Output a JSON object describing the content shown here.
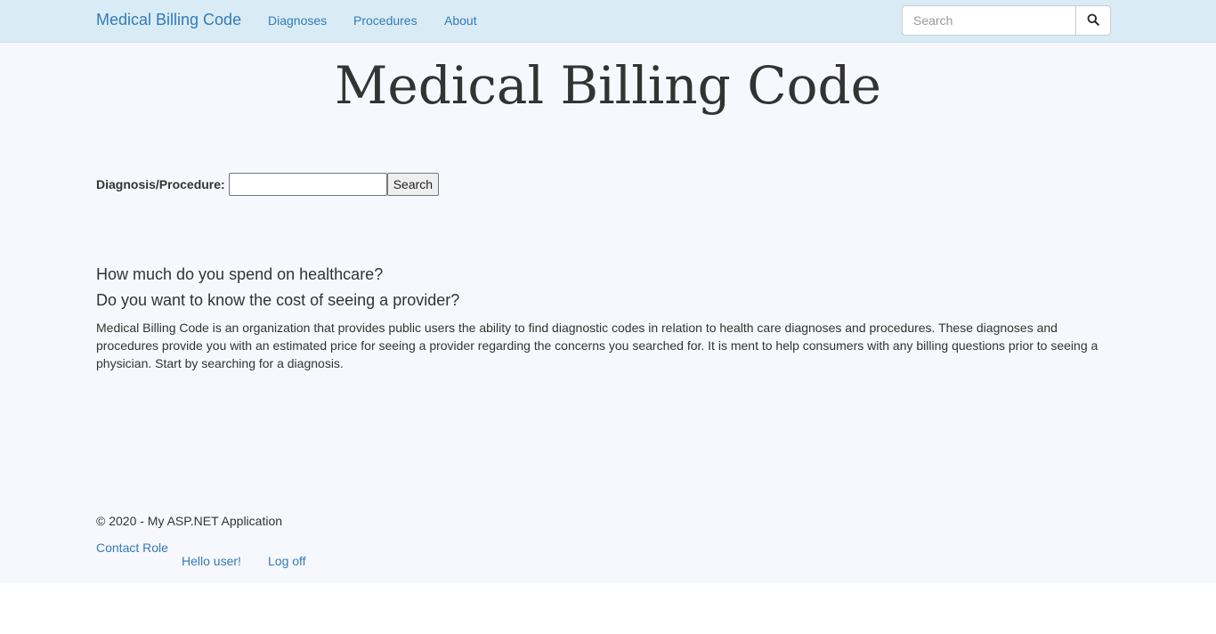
{
  "navbar": {
    "brand": "Medical Billing Code",
    "links": [
      {
        "label": "Diagnoses"
      },
      {
        "label": "Procedures"
      },
      {
        "label": "About"
      }
    ],
    "search": {
      "placeholder": "Search",
      "icon": "search-icon"
    },
    "colors": {
      "background": "#d9ecf5",
      "link": "#337ab7"
    }
  },
  "hero": {
    "title": "Medical Billing Code"
  },
  "search_form": {
    "label": "Diagnosis/Procedure:",
    "value": "",
    "button_label": "Search"
  },
  "info": {
    "question_1": "How much do you spend on healthcare?",
    "question_2": "Do you want to know the cost of seeing a provider?",
    "description": "Medical Billing Code is an organization that provides public users the ability to find diagnostic codes in relation to health care diagnoses and procedures. These diagnoses and procedures provide you with an estimated price for seeing a provider regarding the concerns you searched for. It is ment to help consumers with any billing questions prior to seeing a physician. Start by searching for a diagnosis."
  },
  "footer": {
    "copyright": "© 2020 - My ASP.NET Application",
    "contact_role": "Contact Role",
    "hello_user": "Hello user!",
    "log_off": "Log off"
  }
}
